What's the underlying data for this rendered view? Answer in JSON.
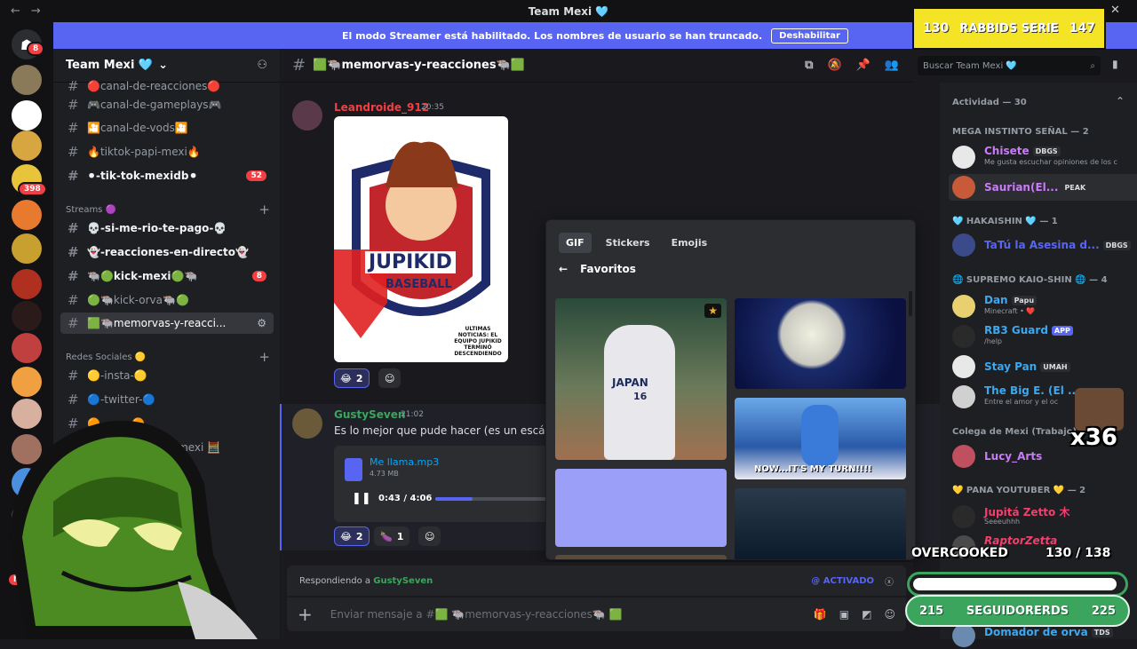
{
  "window": {
    "title": "Team Mexi 🩵"
  },
  "banner": {
    "text": "El modo Streamer está habilitado. Los nombres de usuario se han truncado.",
    "button": "Deshabilitar"
  },
  "guilds": {
    "badges": [
      "8",
      "398",
      "NUE"
    ]
  },
  "server": {
    "name": "Team Mexi 🩵"
  },
  "channels": [
    {
      "name": "🔴canal-de-reacciones🔴",
      "badge": ""
    },
    {
      "name": "🎮canal-de-gameplays🎮",
      "badge": ""
    },
    {
      "name": "🎦canal-de-vods🎦",
      "badge": ""
    },
    {
      "name": "🔥tiktok-papi-mexi🔥",
      "badge": ""
    },
    {
      "name": "⚫-tik-tok-mexidb⚫",
      "badge": "52"
    }
  ],
  "streams_category": "Streams 🟣",
  "streams": [
    {
      "name": "💀-si-me-rio-te-pago-💀",
      "badge": ""
    },
    {
      "name": "👻-reacciones-en-directo👻",
      "badge": ""
    },
    {
      "name": "🐃🟢kick-mexi🟢🐃",
      "badge": "8"
    },
    {
      "name": "🟢🐃kick-orva🐃🟢",
      "badge": ""
    },
    {
      "name": "🟩🐃memorvas-y-reacci...",
      "badge": ""
    }
  ],
  "redes_category": "Redes Sociales 🟡",
  "redes": [
    {
      "name": "🟡-insta-🟡"
    },
    {
      "name": "🔵-twitter-🔵"
    },
    {
      "name": "🟠-...on-🟠"
    },
    {
      "name": "...les-de-mexi 🧮"
    }
  ],
  "chat_header": {
    "channel": "🟩🐃memorvas-y-reacciones🐃🟩"
  },
  "search": {
    "placeholder": "Buscar Team Mexi 🩵"
  },
  "messages": [
    {
      "author": "Leandroide_912",
      "time": "20:35",
      "poster_title_1": "JUPIKID",
      "poster_title_2": "BASEBALL",
      "poster_caption": "ULTIMAS NOTICIAS: EL EQUIPO JUPIKID TERMINÓ DESCENDIENDO",
      "reaction_emoji": "😂",
      "reaction_count": "2"
    },
    {
      "author": "GustySeven",
      "time": "21:02",
      "text": "Es lo mejor que pude hacer (es un escánda",
      "file_name": "Me llama.mp3",
      "file_size": "4.73 MB",
      "audio_time": "0:43 / 4:06",
      "reaction1_emoji": "😂",
      "reaction1_count": "2",
      "reaction2_emoji": "🍆",
      "reaction2_count": "1"
    }
  ],
  "picker": {
    "tabs": [
      "GIF",
      "Stickers",
      "Emojis"
    ],
    "section": "Favoritos",
    "tile_text_japan": "JAPAN",
    "tile_number": "16",
    "tile_caption": "NOW...IT'S MY TURN!!!!"
  },
  "composer": {
    "reply_prefix": "Respondiendo a",
    "reply_user": "GustySeven",
    "mention_state": "@ ACTIVADO",
    "placeholder": "Enviar mensaje a #🟩 🐃memorvas-y-reacciones🐃 🟩"
  },
  "members": {
    "activity": "Actividad — 30",
    "groups": [
      {
        "label": "MEGA INSTINTO SEÑAL — 2"
      },
      {
        "label": "🩵 HAKAISHIN 🩵 — 1"
      },
      {
        "label": "🌐 SUPREMO KAIO-SHIN 🌐 — 4"
      },
      {
        "label": "Colega de Mexi (Trabajo)"
      },
      {
        "label": "💛 PANA YOUTUBER 💛 — 2"
      }
    ],
    "list": [
      {
        "name": "Chisete",
        "tag": "DBGS",
        "status": "Me gusta escuchar opiniones de los c",
        "color": "#c97cf7"
      },
      {
        "name": "Saurian(El...",
        "tag": "PEAK",
        "status": "",
        "color": "#c97cf7"
      },
      {
        "name": "TaTú la Asesina d...",
        "tag": "DBGS",
        "status": "",
        "color": "#5865f2"
      },
      {
        "name": "Dan",
        "tag": "Papu",
        "status": "Minecraft • ❤️",
        "color": "#3ba8f0"
      },
      {
        "name": "RB3 Guard",
        "tag": "APP",
        "status": "/help",
        "color": "#3ba8f0"
      },
      {
        "name": "Stay Pan",
        "tag": "UMAH",
        "status": "",
        "color": "#3ba8f0"
      },
      {
        "name": "The Big E. (El ...",
        "tag": "",
        "status": "Entre el amor y el oc",
        "color": "#3ba8f0"
      },
      {
        "name": "Lucy_Arts",
        "tag": "",
        "status": "",
        "color": "#c97cf7"
      },
      {
        "name": "Jupitá Zetto 木",
        "tag": "",
        "status": "Seeeuhhh",
        "color": "#f23f6d"
      },
      {
        "name": "RaptorZetta",
        "tag": "",
        "status": "",
        "color": "#f23f6d"
      },
      {
        "name": "Domador de orva",
        "tag": "TDS",
        "status": "",
        "color": "#3ba8f0"
      }
    ]
  },
  "overlay": {
    "top_left": "130",
    "top_label": "RABBIDS SERIE",
    "top_right": "147",
    "overcooked": "OVERCOOKED",
    "overcooked_score": "130 / 138",
    "follow_left": "215",
    "follow_label": "SEGUIDORERDS",
    "follow_right": "225",
    "multiplier": "x36"
  },
  "colors": {
    "accent": "#5865f2",
    "green": "#3ba55d",
    "red": "#f23f43",
    "yellow": "#f4e425"
  }
}
